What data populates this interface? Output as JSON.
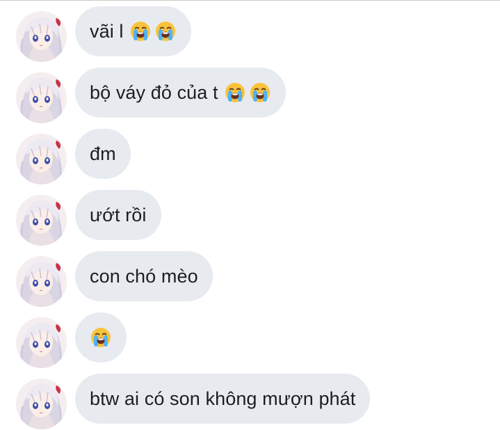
{
  "sender": {
    "avatar_icon": "anime-girl-avatar-icon"
  },
  "colors": {
    "bubble_bg": "#e7ebf0",
    "text": "#1c1e21",
    "emoji_face": "#f9c23c",
    "emoji_tears": "#4fb3f5"
  },
  "messages": [
    {
      "text": "vãi l",
      "emoji": [
        "loudly-crying-face-icon",
        "loudly-crying-face-icon"
      ]
    },
    {
      "text": "bộ váy đỏ của t",
      "emoji": [
        "loudly-crying-face-icon",
        "loudly-crying-face-icon"
      ]
    },
    {
      "text": "đm",
      "emoji": []
    },
    {
      "text": "ướt rồi",
      "emoji": []
    },
    {
      "text": "con chó mèo",
      "emoji": []
    },
    {
      "text": "",
      "emoji": [
        "loudly-crying-face-icon"
      ]
    },
    {
      "text": "btw ai có son không mượn phát",
      "emoji": []
    }
  ]
}
